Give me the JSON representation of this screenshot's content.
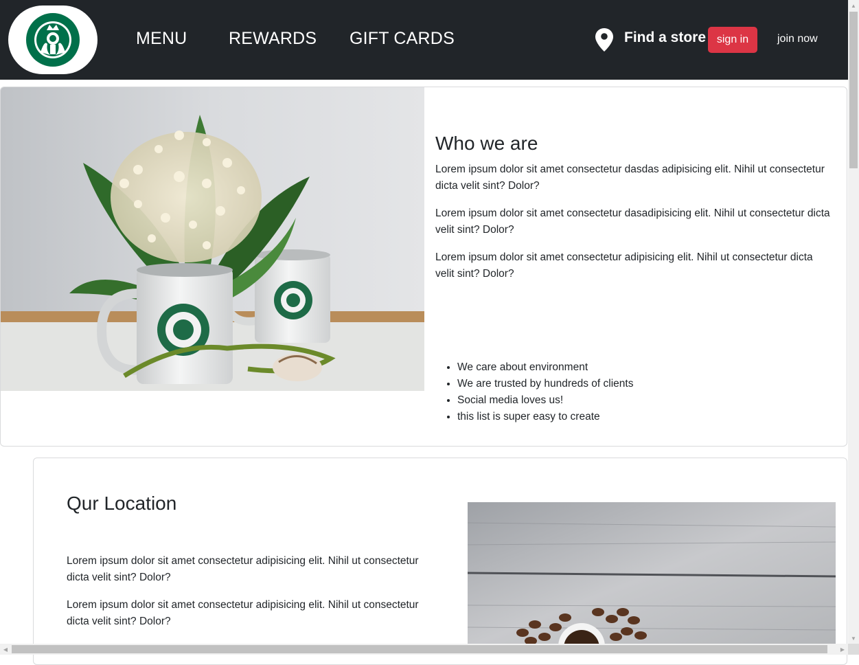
{
  "navbar": {
    "logo_alt": "Starbucks",
    "links": [
      "MENU",
      "REWARDS",
      "GIFT CARDS"
    ],
    "find_store": "Find a store",
    "sign_in": "sign in",
    "join_now": "join now"
  },
  "about": {
    "heading": "Who we are",
    "paragraphs": [
      "Lorem ipsum dolor sit amet consectetur dasdas adipisicing elit. Nihil ut consectetur dicta velit sint? Dolor?",
      "Lorem ipsum dolor sit amet consectetur dasadipisicing elit. Nihil ut consectetur dicta velit sint? Dolor?",
      "Lorem ipsum dolor sit amet consectetur adipisicing elit. Nihil ut consectetur dicta velit sint? Dolor?"
    ],
    "features": [
      "We care about environment",
      "We are trusted by hundreds of clients",
      "Social media loves us!",
      "this list is super easy to create"
    ]
  },
  "location": {
    "heading": "Qur Location",
    "paragraphs": [
      "Lorem ipsum dolor sit amet consectetur adipisicing elit. Nihil ut consectetur dicta velit sint? Dolor?",
      "Lorem ipsum dolor sit amet consectetur adipisicing elit. Nihil ut consectetur dicta velit sint? Dolor?"
    ]
  },
  "colors": {
    "navbar_bg": "#212529",
    "sign_in_bg": "#dc3545",
    "starbucks_green": "#00704a"
  }
}
